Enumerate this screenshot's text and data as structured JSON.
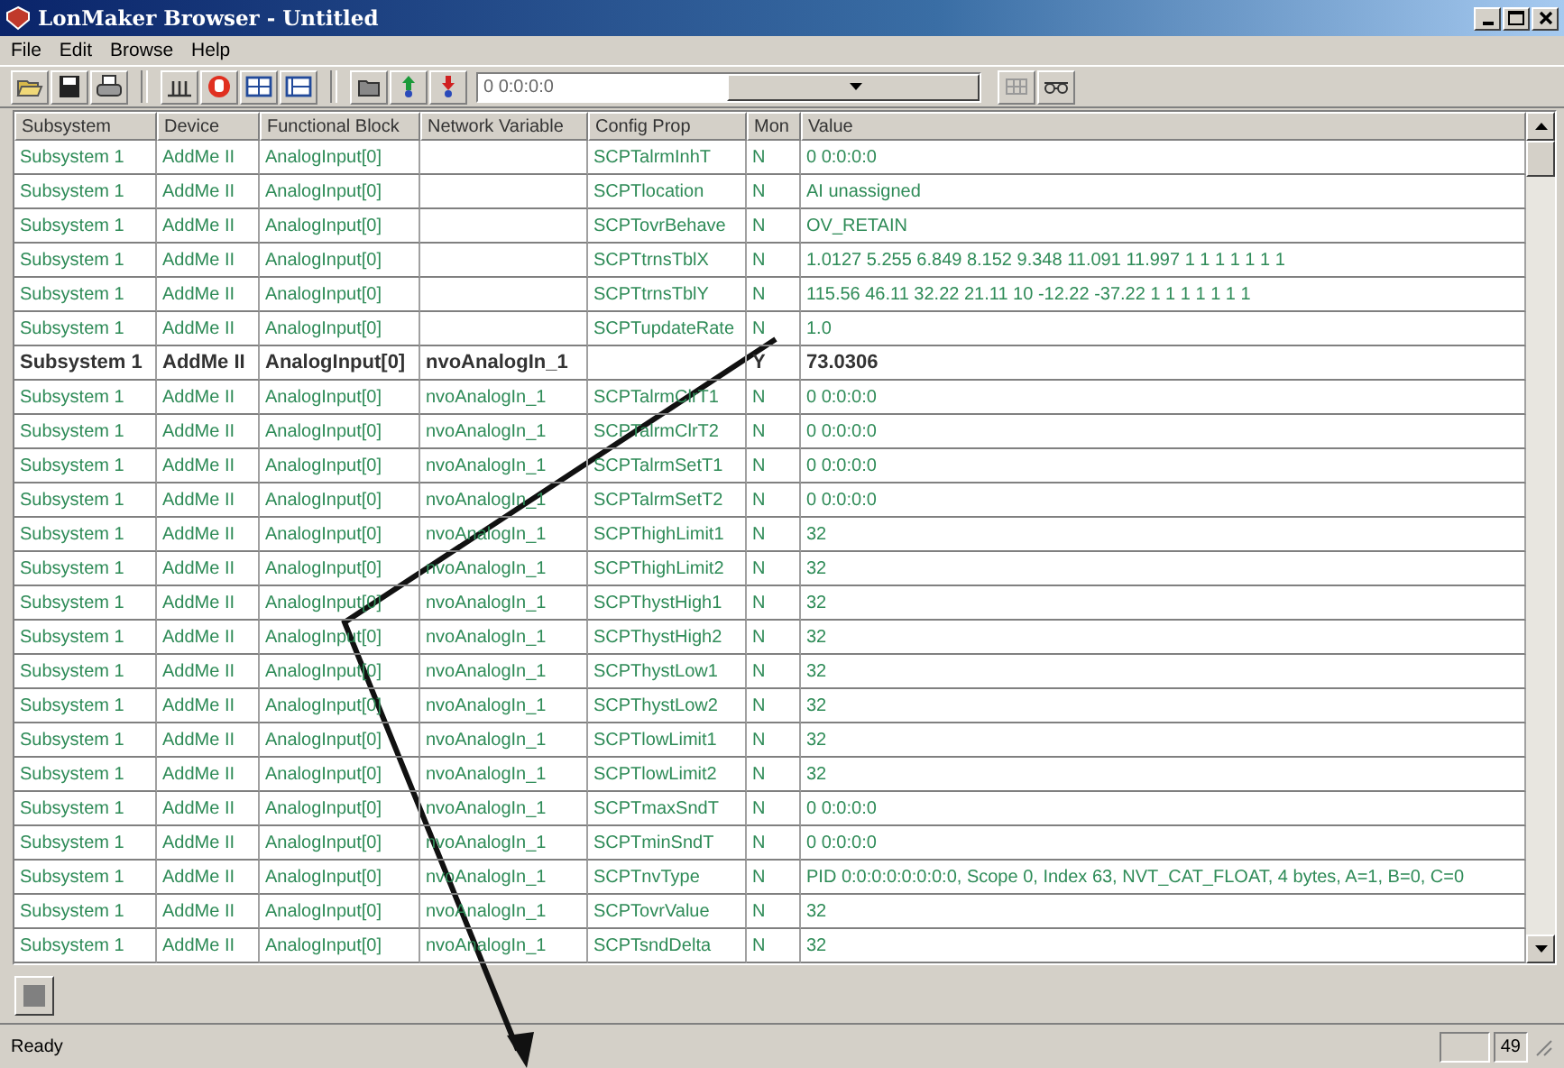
{
  "window": {
    "title": "LonMaker Browser - Untitled"
  },
  "menu": [
    "File",
    "Edit",
    "Browse",
    "Help"
  ],
  "toolbar": {
    "address": "0 0:0:0:0"
  },
  "table": {
    "columns": [
      "Subsystem",
      "Device",
      "Functional Block",
      "Network Variable",
      "Config Prop",
      "Mon",
      "Value"
    ],
    "rows": [
      {
        "kind": "property",
        "cells": [
          "Subsystem 1",
          "AddMe II",
          "AnalogInput[0]",
          "",
          "SCPTalrmInhT",
          "N",
          "0 0:0:0:0"
        ]
      },
      {
        "kind": "property",
        "cells": [
          "Subsystem 1",
          "AddMe II",
          "AnalogInput[0]",
          "",
          "SCPTlocation",
          "N",
          "AI unassigned"
        ]
      },
      {
        "kind": "property",
        "cells": [
          "Subsystem 1",
          "AddMe II",
          "AnalogInput[0]",
          "",
          "SCPTovrBehave",
          "N",
          "OV_RETAIN"
        ]
      },
      {
        "kind": "property",
        "cells": [
          "Subsystem 1",
          "AddMe II",
          "AnalogInput[0]",
          "",
          "SCPTtrnsTblX",
          "N",
          "1.0127 5.255 6.849 8.152 9.348 11.091 11.997 1 1 1 1 1 1 1"
        ]
      },
      {
        "kind": "property",
        "cells": [
          "Subsystem 1",
          "AddMe II",
          "AnalogInput[0]",
          "",
          "SCPTtrnsTblY",
          "N",
          "115.56 46.11 32.22 21.11 10 -12.22 -37.22 1 1 1 1 1 1 1"
        ]
      },
      {
        "kind": "property",
        "cells": [
          "Subsystem 1",
          "AddMe II",
          "AnalogInput[0]",
          "",
          "SCPTupdateRate",
          "N",
          "1.0"
        ]
      },
      {
        "kind": "variable",
        "cells": [
          "Subsystem 1",
          "AddMe II",
          "AnalogInput[0]",
          "nvoAnalogIn_1",
          "",
          "Y",
          "73.0306"
        ]
      },
      {
        "kind": "property",
        "cells": [
          "Subsystem 1",
          "AddMe II",
          "AnalogInput[0]",
          "nvoAnalogIn_1",
          "SCPTalrmClrT1",
          "N",
          "0 0:0:0:0"
        ]
      },
      {
        "kind": "property",
        "cells": [
          "Subsystem 1",
          "AddMe II",
          "AnalogInput[0]",
          "nvoAnalogIn_1",
          "SCPTalrmClrT2",
          "N",
          "0 0:0:0:0"
        ]
      },
      {
        "kind": "property",
        "cells": [
          "Subsystem 1",
          "AddMe II",
          "AnalogInput[0]",
          "nvoAnalogIn_1",
          "SCPTalrmSetT1",
          "N",
          "0 0:0:0:0"
        ]
      },
      {
        "kind": "property",
        "cells": [
          "Subsystem 1",
          "AddMe II",
          "AnalogInput[0]",
          "nvoAnalogIn_1",
          "SCPTalrmSetT2",
          "N",
          "0 0:0:0:0"
        ]
      },
      {
        "kind": "property",
        "cells": [
          "Subsystem 1",
          "AddMe II",
          "AnalogInput[0]",
          "nvoAnalogIn_1",
          "SCPThighLimit1",
          "N",
          "32"
        ]
      },
      {
        "kind": "property",
        "cells": [
          "Subsystem 1",
          "AddMe II",
          "AnalogInput[0]",
          "nvoAnalogIn_1",
          "SCPThighLimit2",
          "N",
          "32"
        ]
      },
      {
        "kind": "property",
        "cells": [
          "Subsystem 1",
          "AddMe II",
          "AnalogInput[0]",
          "nvoAnalogIn_1",
          "SCPThystHigh1",
          "N",
          "32"
        ]
      },
      {
        "kind": "property",
        "cells": [
          "Subsystem 1",
          "AddMe II",
          "AnalogInput[0]",
          "nvoAnalogIn_1",
          "SCPThystHigh2",
          "N",
          "32"
        ]
      },
      {
        "kind": "property",
        "cells": [
          "Subsystem 1",
          "AddMe II",
          "AnalogInput[0]",
          "nvoAnalogIn_1",
          "SCPThystLow1",
          "N",
          "32"
        ]
      },
      {
        "kind": "property",
        "cells": [
          "Subsystem 1",
          "AddMe II",
          "AnalogInput[0]",
          "nvoAnalogIn_1",
          "SCPThystLow2",
          "N",
          "32"
        ]
      },
      {
        "kind": "property",
        "cells": [
          "Subsystem 1",
          "AddMe II",
          "AnalogInput[0]",
          "nvoAnalogIn_1",
          "SCPTlowLimit1",
          "N",
          "32"
        ]
      },
      {
        "kind": "property",
        "cells": [
          "Subsystem 1",
          "AddMe II",
          "AnalogInput[0]",
          "nvoAnalogIn_1",
          "SCPTlowLimit2",
          "N",
          "32"
        ]
      },
      {
        "kind": "property",
        "cells": [
          "Subsystem 1",
          "AddMe II",
          "AnalogInput[0]",
          "nvoAnalogIn_1",
          "SCPTmaxSndT",
          "N",
          "0 0:0:0:0"
        ]
      },
      {
        "kind": "property",
        "cells": [
          "Subsystem 1",
          "AddMe II",
          "AnalogInput[0]",
          "nvoAnalogIn_1",
          "SCPTminSndT",
          "N",
          "0 0:0:0:0"
        ]
      },
      {
        "kind": "property",
        "cells": [
          "Subsystem 1",
          "AddMe II",
          "AnalogInput[0]",
          "nvoAnalogIn_1",
          "SCPTnvType",
          "N",
          "PID 0:0:0:0:0:0:0:0, Scope 0, Index 63, NVT_CAT_FLOAT, 4 bytes, A=1, B=0, C=0"
        ]
      },
      {
        "kind": "property",
        "cells": [
          "Subsystem 1",
          "AddMe II",
          "AnalogInput[0]",
          "nvoAnalogIn_1",
          "SCPTovrValue",
          "N",
          "32"
        ]
      },
      {
        "kind": "property",
        "cells": [
          "Subsystem 1",
          "AddMe II",
          "AnalogInput[0]",
          "nvoAnalogIn_1",
          "SCPTsndDelta",
          "N",
          "32"
        ]
      }
    ]
  },
  "status_bar": {
    "text": "Ready",
    "count": "49"
  }
}
